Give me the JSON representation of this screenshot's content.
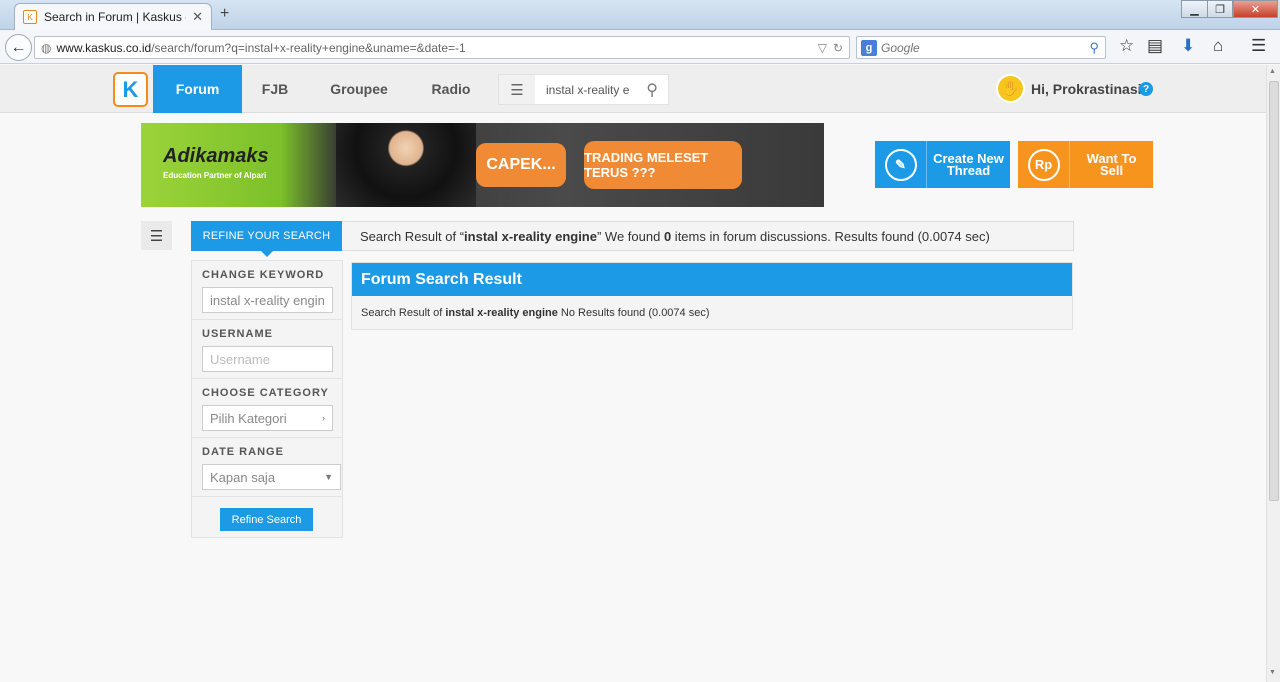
{
  "browser": {
    "tab_title": "Search in Forum | Kaskus - ...",
    "tab_close": "✕",
    "new_tab": "+",
    "url_host": "www.kaskus.co.id",
    "url_path": "/search/forum?q=instal+x-reality+engine&uname=&date=-1",
    "search_placeholder": "Google",
    "search_engine_badge": "g",
    "window_buttons": [
      "▁",
      "❐",
      "✕"
    ]
  },
  "header": {
    "logo_letter": "K",
    "nav": [
      {
        "label": "Forum",
        "active": true
      },
      {
        "label": "FJB"
      },
      {
        "label": "Groupee"
      },
      {
        "label": "Radio"
      }
    ],
    "search_value": "instal x-reality e",
    "greeting": "Hi, Prokrastinasi",
    "help": "?"
  },
  "banner": {
    "brand": "Adikamaks",
    "tagline": "Education Partner of Alpari",
    "bubble1": "CAPEK...",
    "bubble2": "TRADING MELESET TERUS ???"
  },
  "actions": {
    "create_icon": "✎",
    "create_label": "Create New Thread",
    "sell_icon": "Rp",
    "sell_label": "Want To Sell"
  },
  "refine": {
    "tab_label": "REFINE YOUR SEARCH",
    "keyword_label": "CHANGE KEYWORD",
    "keyword_value": "instal x-reality engine",
    "username_label": "USERNAME",
    "username_placeholder": "Username",
    "category_label": "CHOOSE CATEGORY",
    "category_value": "Pilih Kategori",
    "date_label": "DATE RANGE",
    "date_value": "Kapan saja",
    "button": "Refine Search"
  },
  "result_header": {
    "prefix": "Search Result of “",
    "query": "instal x-reality engine",
    "mid": "” We found ",
    "count": "0",
    "suffix": " items in forum discussions. Results found (0.0074 sec)"
  },
  "forum_result": {
    "title": "Forum Search Result",
    "prefix": "Search Result of ",
    "query": "instal x-reality engine",
    "suffix": " No Results found (0.0074 sec)"
  }
}
